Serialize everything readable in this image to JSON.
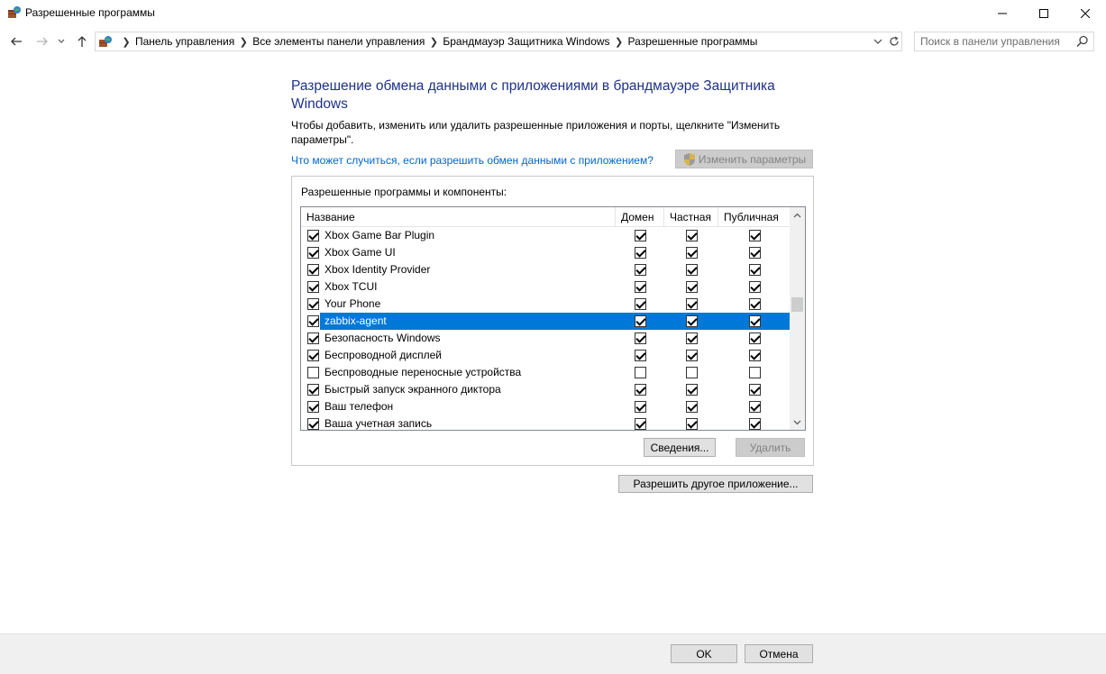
{
  "window": {
    "title": "Разрешенные программы",
    "minimize_icon": "minimize-icon",
    "maximize_icon": "maximize-icon",
    "close_icon": "close-icon"
  },
  "navigation": {
    "breadcrumbs": [
      "Панель управления",
      "Все элементы панели управления",
      "Брандмауэр Защитника Windows",
      "Разрешенные программы"
    ],
    "search_placeholder": "Поиск в панели управления"
  },
  "main": {
    "heading": "Разрешение обмена данными с приложениями в брандмауэре Защитника Windows",
    "description": "Чтобы добавить, изменить или удалить разрешенные приложения и порты, щелкните \"Изменить параметры\".",
    "help_link": "Что может случиться, если разрешить обмен данными с приложением?",
    "change_settings_button": "Изменить параметры",
    "group_label": "Разрешенные программы и компоненты:",
    "columns": [
      "Название",
      "Домен",
      "Частная",
      "Публичная"
    ],
    "rows": [
      {
        "name": "Xbox Game Bar Plugin",
        "enabled": true,
        "domain": true,
        "private": true,
        "public": true,
        "selected": false
      },
      {
        "name": "Xbox Game UI",
        "enabled": true,
        "domain": true,
        "private": true,
        "public": true,
        "selected": false
      },
      {
        "name": "Xbox Identity Provider",
        "enabled": true,
        "domain": true,
        "private": true,
        "public": true,
        "selected": false
      },
      {
        "name": "Xbox TCUI",
        "enabled": true,
        "domain": true,
        "private": true,
        "public": true,
        "selected": false
      },
      {
        "name": "Your Phone",
        "enabled": true,
        "domain": true,
        "private": true,
        "public": true,
        "selected": false
      },
      {
        "name": "zabbix-agent",
        "enabled": true,
        "domain": true,
        "private": true,
        "public": true,
        "selected": true
      },
      {
        "name": "Безопасность Windows",
        "enabled": true,
        "domain": true,
        "private": true,
        "public": true,
        "selected": false
      },
      {
        "name": "Беспроводной дисплей",
        "enabled": true,
        "domain": true,
        "private": true,
        "public": true,
        "selected": false
      },
      {
        "name": "Беспроводные переносные устройства",
        "enabled": false,
        "domain": false,
        "private": false,
        "public": false,
        "selected": false
      },
      {
        "name": "Быстрый запуск экранного диктора",
        "enabled": true,
        "domain": true,
        "private": true,
        "public": true,
        "selected": false
      },
      {
        "name": "Ваш телефон",
        "enabled": true,
        "domain": true,
        "private": true,
        "public": true,
        "selected": false
      },
      {
        "name": "Ваша учетная запись",
        "enabled": true,
        "domain": true,
        "private": true,
        "public": true,
        "selected": false
      }
    ],
    "details_button": "Сведения...",
    "delete_button": "Удалить",
    "allow_other_button": "Разрешить другое приложение..."
  },
  "footer": {
    "ok_button": "OK",
    "cancel_button": "Отмена"
  },
  "colors": {
    "heading": "#1e3287",
    "link": "#0066cc",
    "selection": "#0078d7"
  }
}
